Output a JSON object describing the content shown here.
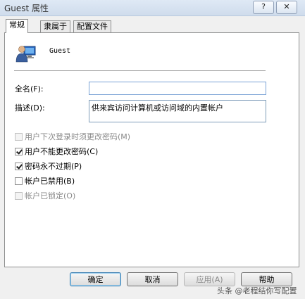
{
  "window": {
    "title": "Guest 属性",
    "help_glyph": "?",
    "close_glyph": "✕"
  },
  "tabs": [
    {
      "label": "常规",
      "active": true
    },
    {
      "label": "隶属于",
      "active": false
    },
    {
      "label": "配置文件",
      "active": false
    }
  ],
  "user": {
    "name": "Guest",
    "icon": "user-computer-icon"
  },
  "fields": {
    "fullname_label": "全名(F):",
    "fullname_value": "",
    "description_label": "描述(D):",
    "description_value": "供来宾访问计算机或访问域的内置帐户"
  },
  "checkboxes": [
    {
      "label": "用户下次登录时须更改密码(M)",
      "checked": false,
      "enabled": false
    },
    {
      "label": "用户不能更改密码(C)",
      "checked": true,
      "enabled": true
    },
    {
      "label": "密码永不过期(P)",
      "checked": true,
      "enabled": true
    },
    {
      "label": "帐户已禁用(B)",
      "checked": false,
      "enabled": true
    },
    {
      "label": "帐户已锁定(O)",
      "checked": false,
      "enabled": false
    }
  ],
  "buttons": {
    "ok": "确定",
    "cancel": "取消",
    "apply": "应用(A)",
    "help": "帮助"
  },
  "watermark": "头条 @老程结你写配置"
}
